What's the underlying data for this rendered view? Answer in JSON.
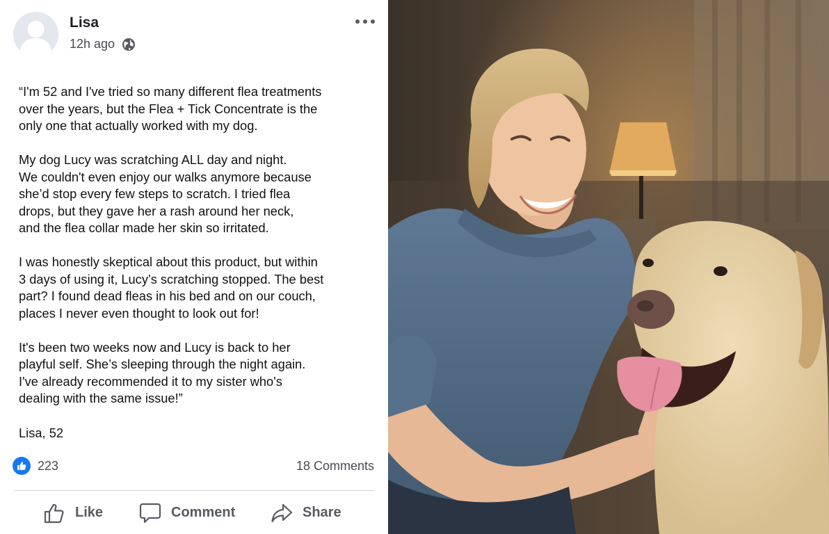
{
  "post": {
    "author": "Lisa",
    "time": "12h ago",
    "icons": {
      "avatar": "default-avatar",
      "privacy": "globe-icon",
      "more": "more-horizontal-icon"
    },
    "paragraphs": [
      "“I'm 52 and I've tried so many different flea treatments\nover the years, but the Flea + Tick Concentrate is the\nonly one that actually worked with my dog.",
      "My dog Lucy was scratching ALL day and night.\nWe couldn't even enjoy our walks anymore because\nshe’d stop every few steps to scratch. I tried flea\ndrops, but they gave her a rash around her neck,\nand the flea collar made her skin so irritated.",
      "I was honestly skeptical about this product, but within\n3 days of using it, Lucy’s scratching stopped. The best\npart? I found dead fleas in his bed and on our couch,\nplaces I never even thought to look out for!",
      "It's been two weeks now and Lucy is back to her\nplayful self. She’s sleeping through the night again.\nI've already recommended it to my sister who's\ndealing with the same issue!”"
    ],
    "signature": "Lisa, 52",
    "likes": "223",
    "comments": "18 Comments",
    "actions": {
      "like": "Like",
      "comment": "Comment",
      "share": "Share"
    }
  },
  "colors": {
    "accent": "#1877f2",
    "muted_text": "#474a50",
    "action_text": "#575a60"
  }
}
